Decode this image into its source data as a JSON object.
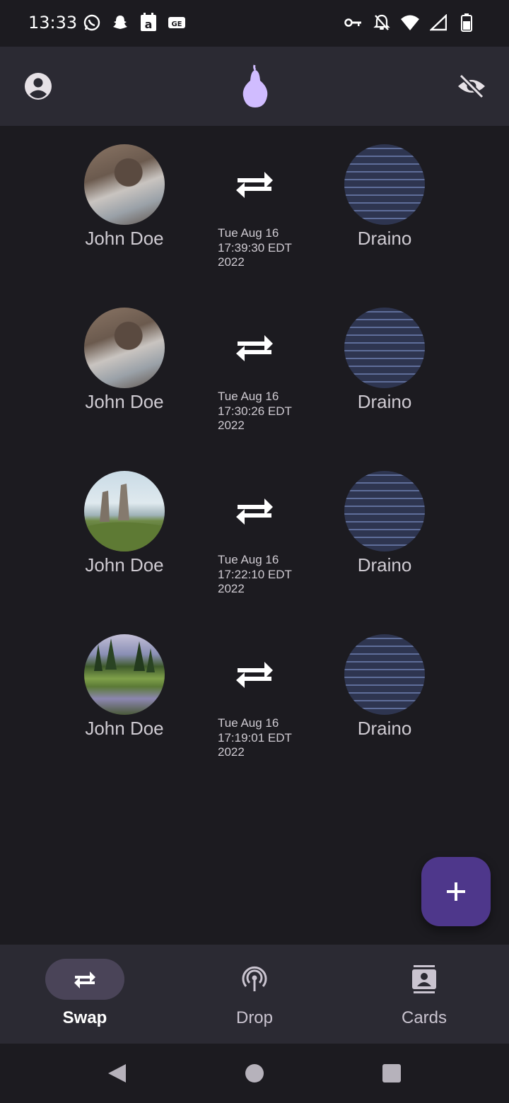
{
  "status_bar": {
    "time": "13:33",
    "left_icons": [
      "whatsapp-icon",
      "snapchat-icon",
      "amazon-icon",
      "gmail-icon"
    ],
    "right_icons": [
      "vpn-key-icon",
      "notifications-off-icon",
      "wifi-icon",
      "signal-icon",
      "battery-icon"
    ]
  },
  "app_bar": {
    "left_icon": "account-circle-icon",
    "logo_icon": "pear-logo-icon",
    "right_icon": "visibility-off-icon"
  },
  "swaps": [
    {
      "left_name": "John Doe",
      "right_name": "Draino",
      "timestamp": "Tue Aug 16 17:39:30 EDT 2022"
    },
    {
      "left_name": "John Doe",
      "right_name": "Draino",
      "timestamp": "Tue Aug 16 17:30:26 EDT 2022"
    },
    {
      "left_name": "John Doe",
      "right_name": "Draino",
      "timestamp": "Tue Aug 16 17:22:10 EDT 2022"
    },
    {
      "left_name": "John Doe",
      "right_name": "Draino",
      "timestamp": "Tue Aug 16 17:19:01 EDT 2022"
    }
  ],
  "fab": {
    "icon": "add-icon"
  },
  "bottom_nav": {
    "items": [
      {
        "label": "Swap",
        "icon": "swap-horiz-icon",
        "active": true
      },
      {
        "label": "Drop",
        "icon": "broadcast-icon",
        "active": false
      },
      {
        "label": "Cards",
        "icon": "contacts-icon",
        "active": false
      }
    ]
  },
  "colors": {
    "background": "#1c1b20",
    "surface": "#2b2a33",
    "accent": "#4e378b",
    "logo": "#d0bcff"
  }
}
